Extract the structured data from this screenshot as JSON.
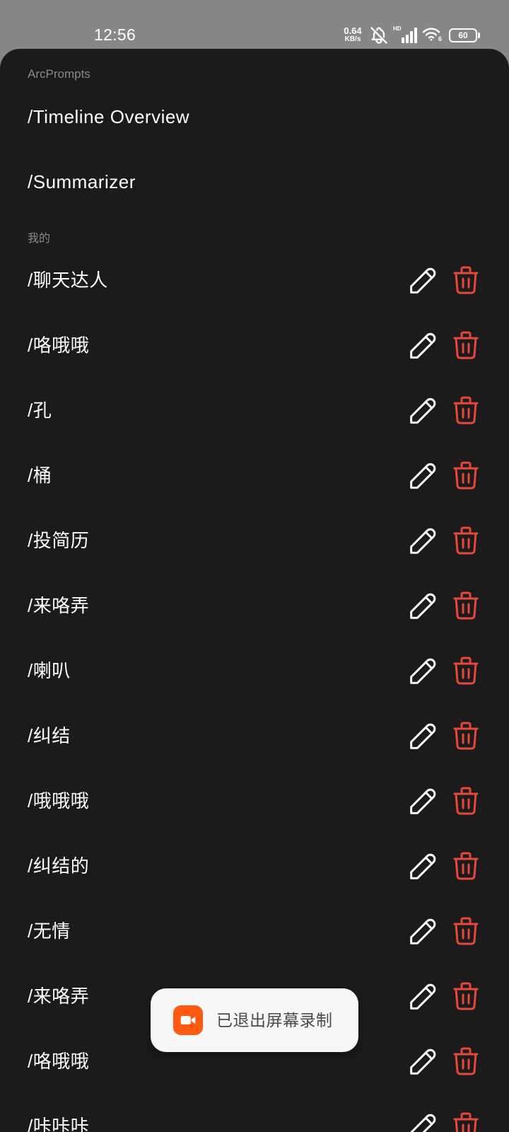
{
  "status_bar": {
    "time": "12:56",
    "network_speed": {
      "value": "0.64",
      "unit": "KB/s"
    },
    "signal_label": "HD",
    "wifi_generation": "6",
    "battery_level": "60",
    "icons": {
      "mute": "bell-off-icon",
      "signal": "cellular-signal-icon",
      "wifi": "wifi-icon",
      "battery": "battery-icon"
    }
  },
  "sheet": {
    "builtin": {
      "header": "ArcPrompts",
      "items": [
        {
          "label": "/Timeline Overview"
        },
        {
          "label": "/Summarizer"
        }
      ]
    },
    "my_prompts": {
      "header": "我的",
      "item_actions": {
        "edit_icon": "pencil-icon",
        "delete_icon": "trash-icon"
      },
      "items": [
        {
          "label": "/聊天达人"
        },
        {
          "label": "/咯哦哦"
        },
        {
          "label": "/孔"
        },
        {
          "label": "/桶"
        },
        {
          "label": "/投简历"
        },
        {
          "label": "/来咯弄"
        },
        {
          "label": "/喇叭"
        },
        {
          "label": "/纠结"
        },
        {
          "label": "/哦哦哦"
        },
        {
          "label": "/纠结的"
        },
        {
          "label": "/无情"
        },
        {
          "label": "/来咯弄"
        },
        {
          "label": "/咯哦哦"
        },
        {
          "label": "/咔咔咔"
        }
      ]
    }
  },
  "toast": {
    "icon": "video-camera-icon",
    "message": "已退出屏幕录制"
  },
  "colors": {
    "status_bar_background": "#878787",
    "sheet_background": "#1b1b1b",
    "primary_text": "#ffffff",
    "section_header_text": "#8a8a8a",
    "delete_accent": "#e8473d",
    "toast_background": "#f6f6f6",
    "toast_icon": "#ff5a12"
  }
}
